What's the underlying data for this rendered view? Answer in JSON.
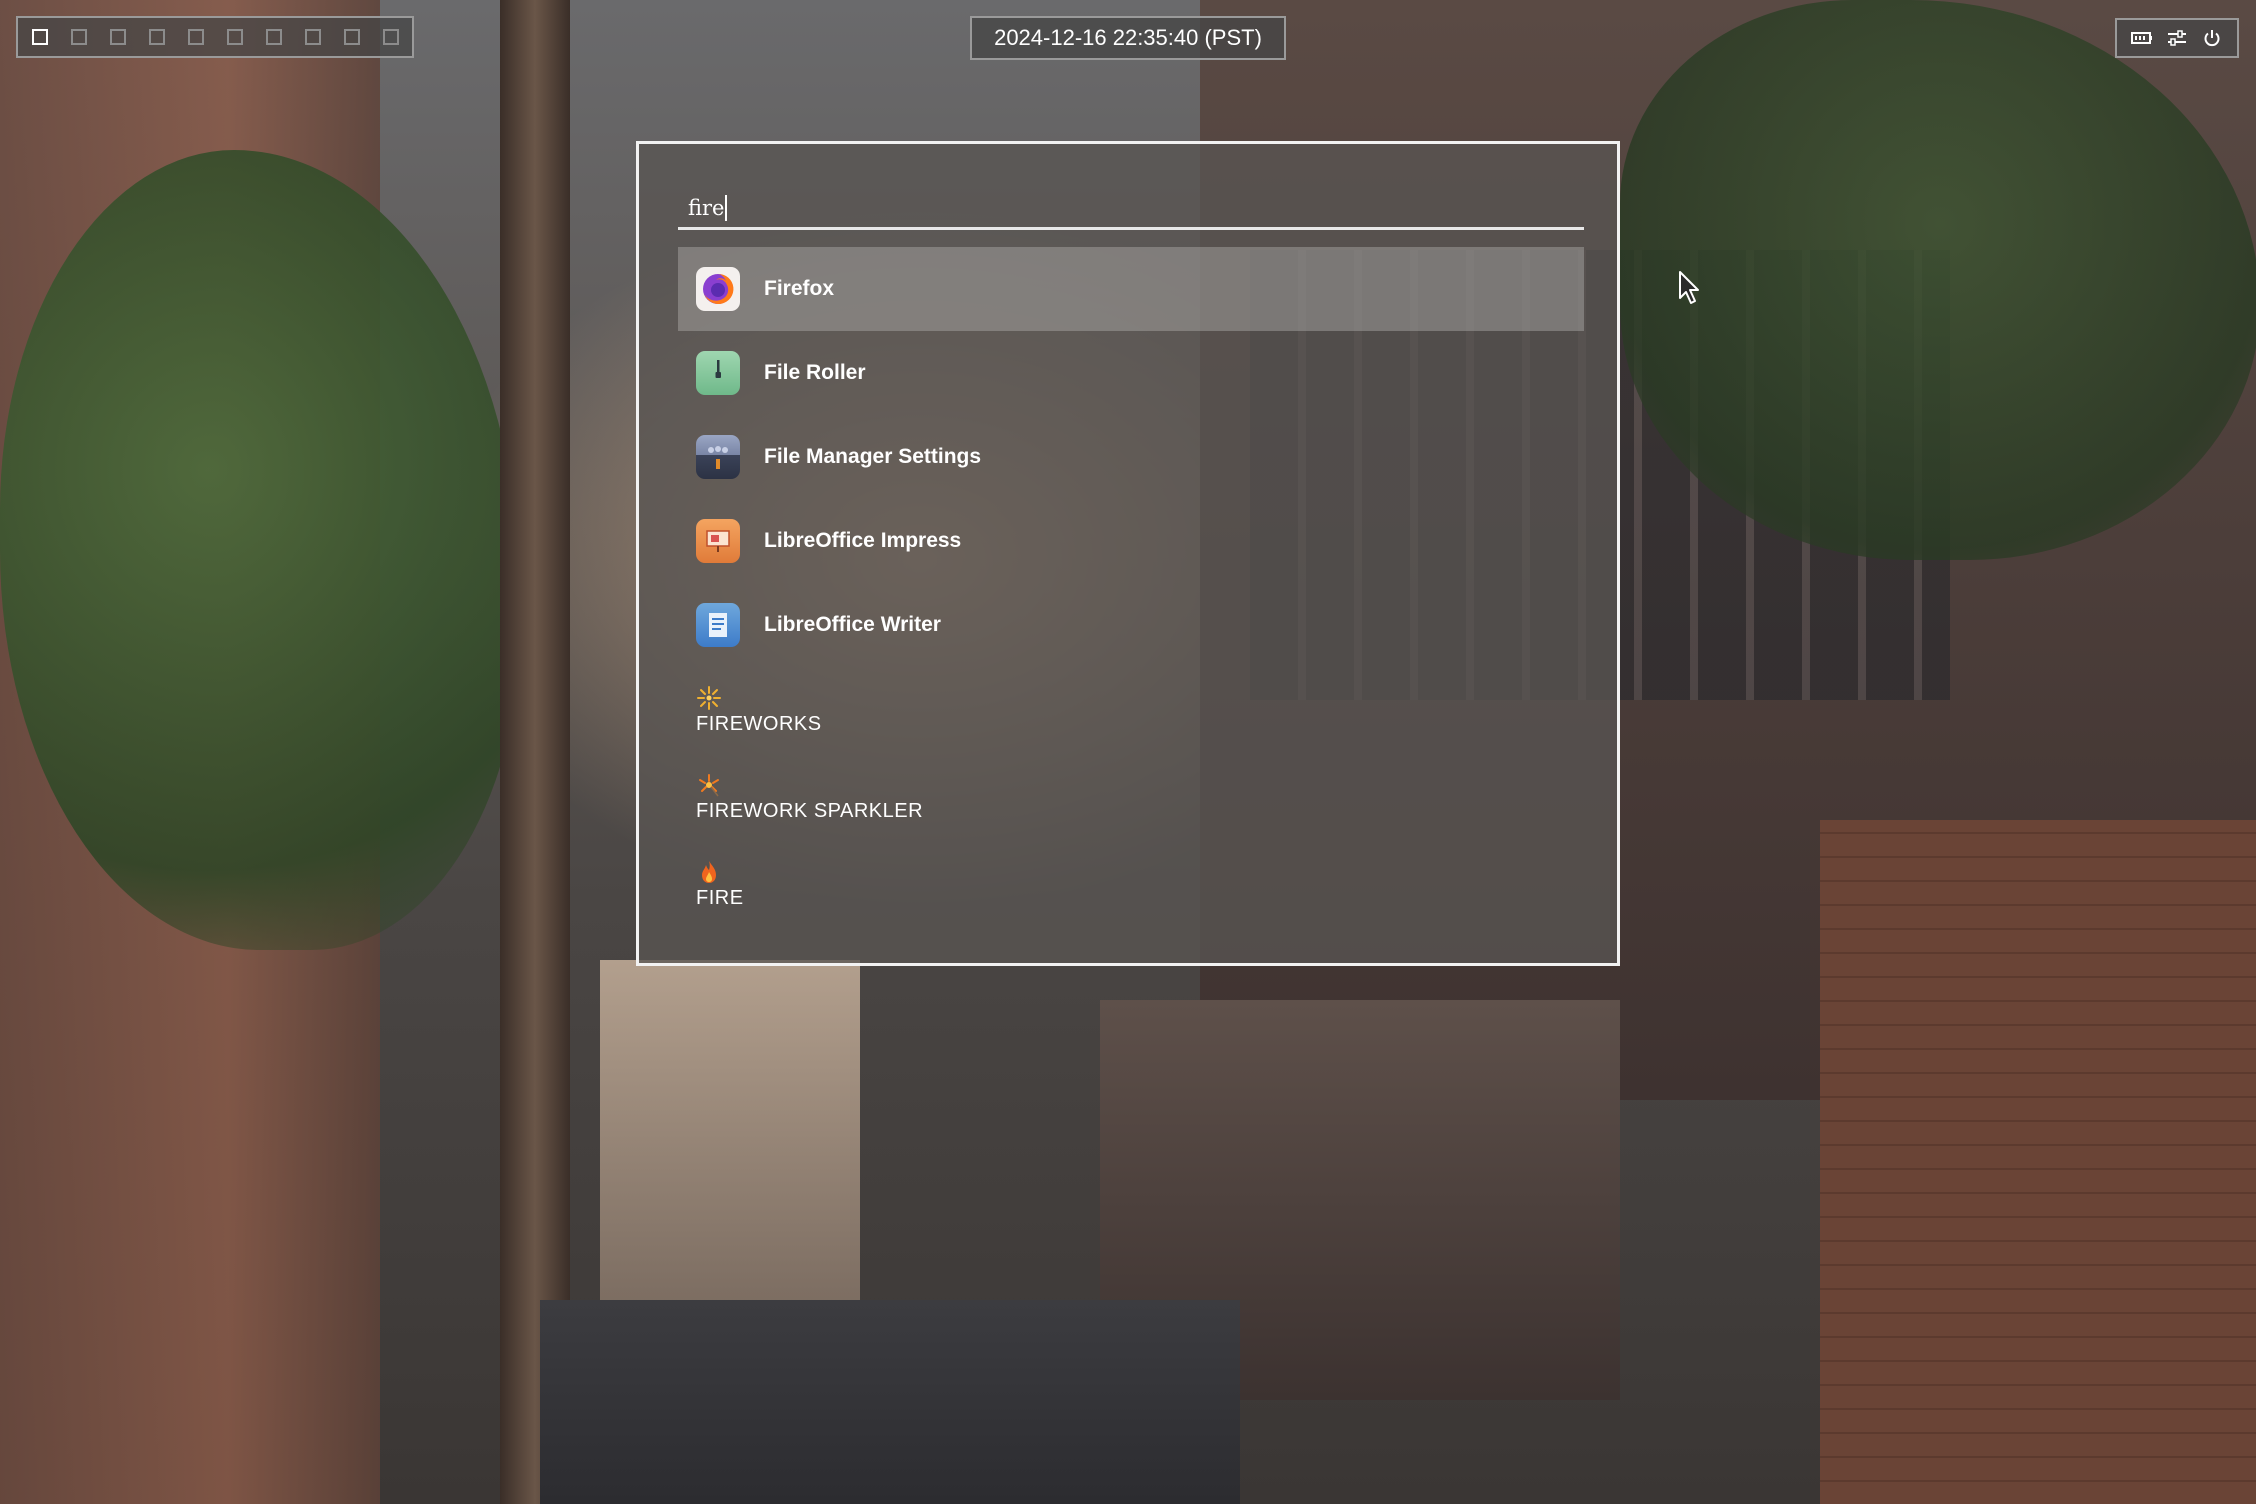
{
  "topbar": {
    "workspaces": [
      {
        "id": "1",
        "active": true
      },
      {
        "id": "2",
        "active": false
      },
      {
        "id": "3",
        "active": false
      },
      {
        "id": "4",
        "active": false
      },
      {
        "id": "5",
        "active": false
      },
      {
        "id": "6",
        "active": false
      },
      {
        "id": "7",
        "active": false
      },
      {
        "id": "8",
        "active": false
      },
      {
        "id": "9",
        "active": false
      },
      {
        "id": "10",
        "active": false
      }
    ],
    "clock": "2024-12-16 22:35:40 (PST)",
    "tray_icons": [
      "battery-icon",
      "settings-sliders-icon",
      "power-icon"
    ]
  },
  "launcher": {
    "query": "fire",
    "apps": [
      {
        "label": "Firefox",
        "icon": "firefox-icon",
        "selected": true
      },
      {
        "label": "File Roller",
        "icon": "file-roller-icon",
        "selected": false
      },
      {
        "label": "File Manager Settings",
        "icon": "file-manager-settings-icon",
        "selected": false
      },
      {
        "label": "LibreOffice Impress",
        "icon": "libreoffice-impress-icon",
        "selected": false
      },
      {
        "label": "LibreOffice Writer",
        "icon": "libreoffice-writer-icon",
        "selected": false
      }
    ],
    "emoji": [
      {
        "label": "FIREWORKS",
        "icon": "fireworks-icon"
      },
      {
        "label": "FIREWORK SPARKLER",
        "icon": "firework-sparkler-icon"
      },
      {
        "label": "FIRE",
        "icon": "fire-icon"
      }
    ]
  },
  "colors": {
    "launcher_border": "#f2f2f2",
    "selected_row": "#afacaa",
    "text": "#ffffff"
  }
}
